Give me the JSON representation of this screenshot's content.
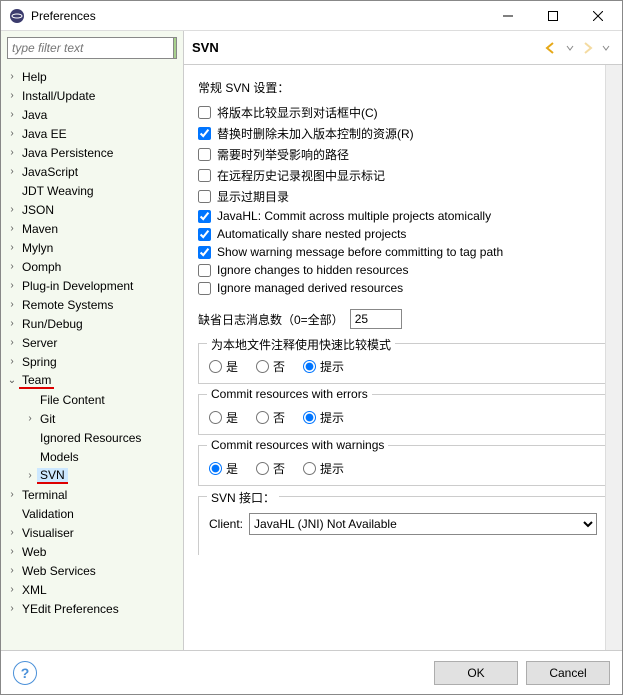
{
  "window": {
    "title": "Preferences"
  },
  "filter": {
    "placeholder": "type filter text"
  },
  "tree": {
    "items": [
      {
        "label": "Help",
        "depth": 1,
        "arrow": ">"
      },
      {
        "label": "Install/Update",
        "depth": 1,
        "arrow": ">"
      },
      {
        "label": "Java",
        "depth": 1,
        "arrow": ">"
      },
      {
        "label": "Java EE",
        "depth": 1,
        "arrow": ">"
      },
      {
        "label": "Java Persistence",
        "depth": 1,
        "arrow": ">"
      },
      {
        "label": "JavaScript",
        "depth": 1,
        "arrow": ">"
      },
      {
        "label": "JDT Weaving",
        "depth": 1,
        "arrow": ""
      },
      {
        "label": "JSON",
        "depth": 1,
        "arrow": ">"
      },
      {
        "label": "Maven",
        "depth": 1,
        "arrow": ">"
      },
      {
        "label": "Mylyn",
        "depth": 1,
        "arrow": ">"
      },
      {
        "label": "Oomph",
        "depth": 1,
        "arrow": ">"
      },
      {
        "label": "Plug-in Development",
        "depth": 1,
        "arrow": ">"
      },
      {
        "label": "Remote Systems",
        "depth": 1,
        "arrow": ">"
      },
      {
        "label": "Run/Debug",
        "depth": 1,
        "arrow": ">"
      },
      {
        "label": "Server",
        "depth": 1,
        "arrow": ">"
      },
      {
        "label": "Spring",
        "depth": 1,
        "arrow": ">"
      },
      {
        "label": "Team",
        "depth": 1,
        "arrow": "v",
        "mark": true
      },
      {
        "label": "File Content",
        "depth": 2,
        "arrow": ""
      },
      {
        "label": "Git",
        "depth": 2,
        "arrow": ">"
      },
      {
        "label": "Ignored Resources",
        "depth": 2,
        "arrow": ""
      },
      {
        "label": "Models",
        "depth": 2,
        "arrow": ""
      },
      {
        "label": "SVN",
        "depth": 2,
        "arrow": ">",
        "mark": true,
        "sel": true
      },
      {
        "label": "Terminal",
        "depth": 1,
        "arrow": ">"
      },
      {
        "label": "Validation",
        "depth": 1,
        "arrow": ""
      },
      {
        "label": "Visualiser",
        "depth": 1,
        "arrow": ">"
      },
      {
        "label": "Web",
        "depth": 1,
        "arrow": ">"
      },
      {
        "label": "Web Services",
        "depth": 1,
        "arrow": ">"
      },
      {
        "label": "XML",
        "depth": 1,
        "arrow": ">"
      },
      {
        "label": "YEdit Preferences",
        "depth": 1,
        "arrow": ">"
      }
    ]
  },
  "page": {
    "title": "SVN",
    "section_general": "常规 SVN 设置：",
    "checks": [
      {
        "label": "将版本比较显示到对话框中(C)",
        "checked": false
      },
      {
        "label": "替换时删除未加入版本控制的资源(R)",
        "checked": true
      },
      {
        "label": "需要时列举受影响的路径",
        "checked": false
      },
      {
        "label": "在远程历史记录视图中显示标记",
        "checked": false
      },
      {
        "label": "显示过期目录",
        "checked": false
      },
      {
        "label": "JavaHL: Commit across multiple projects atomically",
        "checked": true
      },
      {
        "label": "Automatically share nested projects",
        "checked": true
      },
      {
        "label": "Show warning message before committing to tag path",
        "checked": true
      },
      {
        "label": "Ignore changes to hidden resources",
        "checked": false
      },
      {
        "label": "Ignore managed derived resources",
        "checked": false
      }
    ],
    "log_label": "缺省日志消息数（0=全部）",
    "log_value": "25",
    "grp_quickdiff": {
      "title": "为本地文件注释使用快速比较模式",
      "opts": [
        "是",
        "否",
        "提示"
      ],
      "sel": 2
    },
    "grp_err": {
      "title": "Commit resources with errors",
      "opts": [
        "是",
        "否",
        "提示"
      ],
      "sel": 2
    },
    "grp_warn": {
      "title": "Commit resources with warnings",
      "opts": [
        "是",
        "否",
        "提示"
      ],
      "sel": 0
    },
    "svn_interface": {
      "title": "SVN 接口：",
      "client_label": "Client:",
      "client_value": "JavaHL (JNI) Not Available"
    }
  },
  "footer": {
    "ok": "OK",
    "cancel": "Cancel"
  }
}
